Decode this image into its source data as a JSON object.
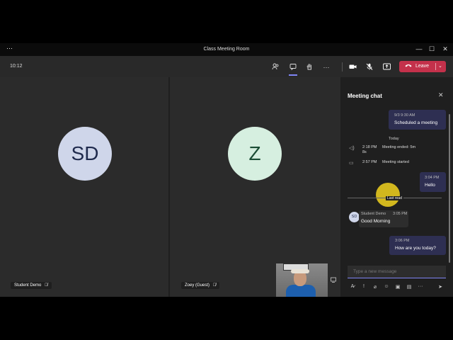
{
  "window": {
    "title": "Class Meeting Room",
    "more_icon": "ellipsis-icon",
    "controls": [
      "—",
      "☐",
      "✕"
    ]
  },
  "toolbar": {
    "timer": "10:12",
    "leave_label": "Leave",
    "icons": [
      "people-icon",
      "chat-icon",
      "raise-hand-icon",
      "more-icon",
      "camera-icon",
      "mic-off-icon",
      "share-icon"
    ]
  },
  "participants": [
    {
      "initials": "SD",
      "name": "Student Demo",
      "color": "#cfd6ea"
    },
    {
      "initials": "Z",
      "name": "Zoey (Guest)",
      "color": "#d6efe0"
    }
  ],
  "chat": {
    "title": "Meeting chat",
    "messages": [
      {
        "time": "9/3 9:30 AM",
        "text": "Scheduled a meeting"
      },
      {
        "time": "3:04 PM",
        "text": "Hello"
      },
      {
        "time": "3:06 PM",
        "text": "How are you today?"
      }
    ],
    "today_label": "Today",
    "system": [
      {
        "time": "2:18 PM",
        "text": "Meeting ended: 5m",
        "extra": "8s"
      },
      {
        "time": "2:57 PM",
        "text": "Meeting started"
      }
    ],
    "last_read_label": "Last read",
    "incoming": {
      "sender": "Student Demo",
      "time": "3:05 PM",
      "text": "Good Morning",
      "avatar": "SD"
    },
    "compose_placeholder": "Type a new message"
  },
  "colors": {
    "accent": "#7f85f5",
    "leave": "#c4314b",
    "bubble": "#2e2f52",
    "highlight": "#e6c81e"
  }
}
